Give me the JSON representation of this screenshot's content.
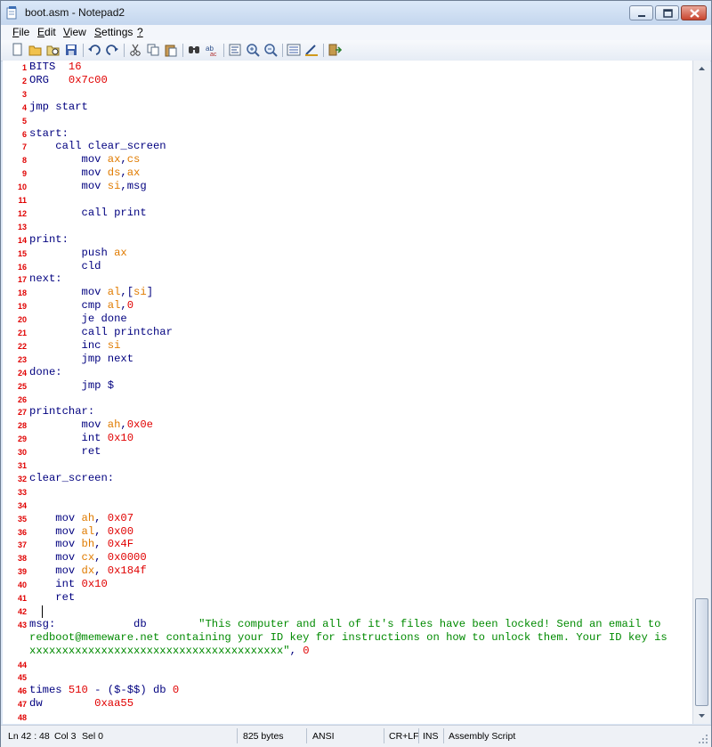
{
  "window": {
    "title": "boot.asm - Notepad2"
  },
  "menu": [
    {
      "acc": "F",
      "rest": "ile"
    },
    {
      "acc": "E",
      "rest": "dit"
    },
    {
      "acc": "V",
      "rest": "iew"
    },
    {
      "acc": "S",
      "rest": "ettings"
    },
    {
      "acc": "?",
      "rest": ""
    }
  ],
  "toolbar": [
    "new-file-icon",
    "open-folder-icon",
    "browse-icon",
    "save-icon",
    "undo-icon",
    "redo-icon",
    "cut-icon",
    "copy-icon",
    "paste-icon",
    "find-icon",
    "replace-icon",
    "word-wrap-icon",
    "zoom-in-icon",
    "zoom-out-icon",
    "scheme-icon",
    "customize-schemes-icon",
    "exit-icon"
  ],
  "editor": {
    "lines": [
      {
        "n": "1",
        "tokens": [
          [
            "kw",
            "BITS  "
          ],
          [
            "num",
            "16"
          ]
        ]
      },
      {
        "n": "2",
        "tokens": [
          [
            "kw",
            "ORG   "
          ],
          [
            "num",
            "0x7c00"
          ]
        ]
      },
      {
        "n": "3",
        "tokens": []
      },
      {
        "n": "4",
        "tokens": [
          [
            "kw",
            "jmp start"
          ]
        ]
      },
      {
        "n": "5",
        "tokens": []
      },
      {
        "n": "6",
        "tokens": [
          [
            "kw",
            "start:"
          ]
        ]
      },
      {
        "n": "7",
        "tokens": [
          [
            "kw",
            "    call clear_screen"
          ]
        ]
      },
      {
        "n": "8",
        "tokens": [
          [
            "kw",
            "        mov "
          ],
          [
            "reg",
            "ax"
          ],
          [
            "kw",
            ","
          ],
          [
            "reg",
            "cs"
          ]
        ]
      },
      {
        "n": "9",
        "tokens": [
          [
            "kw",
            "        mov "
          ],
          [
            "reg",
            "ds"
          ],
          [
            "kw",
            ","
          ],
          [
            "reg",
            "ax"
          ]
        ]
      },
      {
        "n": "10",
        "tokens": [
          [
            "kw",
            "        mov "
          ],
          [
            "reg",
            "si"
          ],
          [
            "kw",
            ",msg"
          ]
        ]
      },
      {
        "n": "11",
        "tokens": []
      },
      {
        "n": "12",
        "tokens": [
          [
            "kw",
            "        call print"
          ]
        ]
      },
      {
        "n": "13",
        "tokens": []
      },
      {
        "n": "14",
        "tokens": [
          [
            "kw",
            "print:"
          ]
        ]
      },
      {
        "n": "15",
        "tokens": [
          [
            "kw",
            "        push "
          ],
          [
            "reg",
            "ax"
          ]
        ]
      },
      {
        "n": "16",
        "tokens": [
          [
            "kw",
            "        cld"
          ]
        ]
      },
      {
        "n": "17",
        "tokens": [
          [
            "kw",
            "next:"
          ]
        ]
      },
      {
        "n": "18",
        "tokens": [
          [
            "kw",
            "        mov "
          ],
          [
            "reg",
            "al"
          ],
          [
            "kw",
            ",["
          ],
          [
            "reg",
            "si"
          ],
          [
            "kw",
            "]"
          ]
        ]
      },
      {
        "n": "19",
        "tokens": [
          [
            "kw",
            "        cmp "
          ],
          [
            "reg",
            "al"
          ],
          [
            "kw",
            ","
          ],
          [
            "num",
            "0"
          ]
        ]
      },
      {
        "n": "20",
        "tokens": [
          [
            "kw",
            "        je done"
          ]
        ]
      },
      {
        "n": "21",
        "tokens": [
          [
            "kw",
            "        call printchar"
          ]
        ]
      },
      {
        "n": "22",
        "tokens": [
          [
            "kw",
            "        inc "
          ],
          [
            "reg",
            "si"
          ]
        ]
      },
      {
        "n": "23",
        "tokens": [
          [
            "kw",
            "        jmp next"
          ]
        ]
      },
      {
        "n": "24",
        "tokens": [
          [
            "kw",
            "done:"
          ]
        ]
      },
      {
        "n": "25",
        "tokens": [
          [
            "kw",
            "        jmp $"
          ]
        ]
      },
      {
        "n": "26",
        "tokens": []
      },
      {
        "n": "27",
        "tokens": [
          [
            "kw",
            "printchar:"
          ]
        ]
      },
      {
        "n": "28",
        "tokens": [
          [
            "kw",
            "        mov "
          ],
          [
            "reg",
            "ah"
          ],
          [
            "kw",
            ","
          ],
          [
            "num",
            "0x0e"
          ]
        ]
      },
      {
        "n": "29",
        "tokens": [
          [
            "kw",
            "        int "
          ],
          [
            "num",
            "0x10"
          ]
        ]
      },
      {
        "n": "30",
        "tokens": [
          [
            "kw",
            "        ret"
          ]
        ]
      },
      {
        "n": "31",
        "tokens": []
      },
      {
        "n": "32",
        "tokens": [
          [
            "kw",
            "clear_screen:"
          ]
        ]
      },
      {
        "n": "33",
        "tokens": []
      },
      {
        "n": "34",
        "tokens": []
      },
      {
        "n": "35",
        "tokens": [
          [
            "kw",
            "    mov "
          ],
          [
            "reg",
            "ah"
          ],
          [
            "kw",
            ", "
          ],
          [
            "num",
            "0x07"
          ]
        ]
      },
      {
        "n": "36",
        "tokens": [
          [
            "kw",
            "    mov "
          ],
          [
            "reg",
            "al"
          ],
          [
            "kw",
            ", "
          ],
          [
            "num",
            "0x00"
          ]
        ]
      },
      {
        "n": "37",
        "tokens": [
          [
            "kw",
            "    mov "
          ],
          [
            "reg",
            "bh"
          ],
          [
            "kw",
            ", "
          ],
          [
            "num",
            "0x4F"
          ]
        ]
      },
      {
        "n": "38",
        "tokens": [
          [
            "kw",
            "    mov "
          ],
          [
            "reg",
            "cx"
          ],
          [
            "kw",
            ", "
          ],
          [
            "num",
            "0x0000"
          ]
        ]
      },
      {
        "n": "39",
        "tokens": [
          [
            "kw",
            "    mov "
          ],
          [
            "reg",
            "dx"
          ],
          [
            "kw",
            ", "
          ],
          [
            "num",
            "0x184f"
          ]
        ]
      },
      {
        "n": "40",
        "tokens": [
          [
            "kw",
            "    int "
          ],
          [
            "num",
            "0x10"
          ]
        ]
      },
      {
        "n": "41",
        "tokens": [
          [
            "kw",
            "    ret"
          ]
        ]
      },
      {
        "n": "42",
        "tokens": []
      },
      {
        "n": "43",
        "tokens": [
          [
            "kw",
            "msg:            db        "
          ],
          [
            "str",
            "\"This computer and all of it's files have been locked! Send an email to"
          ]
        ]
      },
      {
        "n": "",
        "tokens": [
          [
            "str",
            "redboot@memeware.net containing your ID key for instructions on how to unlock them. Your ID key is"
          ]
        ]
      },
      {
        "n": "",
        "tokens": [
          [
            "str",
            "xxxxxxxxxxxxxxxxxxxxxxxxxxxxxxxxxxxxxxx\""
          ],
          [
            "kw",
            ", "
          ],
          [
            "num",
            "0"
          ]
        ]
      },
      {
        "n": "44",
        "tokens": []
      },
      {
        "n": "45",
        "tokens": []
      },
      {
        "n": "46",
        "tokens": [
          [
            "kw",
            "times "
          ],
          [
            "num",
            "510"
          ],
          [
            "kw",
            " - ($-$$) db "
          ],
          [
            "num",
            "0"
          ]
        ]
      },
      {
        "n": "47",
        "tokens": [
          [
            "kw",
            "dw        "
          ],
          [
            "num",
            "0xaa55"
          ]
        ]
      },
      {
        "n": "48",
        "tokens": []
      }
    ]
  },
  "status": {
    "position": "Ln 42 : 48",
    "col": "Col 3",
    "sel": "Sel 0",
    "size": "825 bytes",
    "encoding": "ANSI",
    "eol": "CR+LF",
    "mode": "INS",
    "lexer": "Assembly Script"
  },
  "colors": {
    "keyword": "#00007f",
    "register": "#e07b00",
    "number": "#e00000",
    "string": "#008a00",
    "linenumber": "#e00000"
  }
}
